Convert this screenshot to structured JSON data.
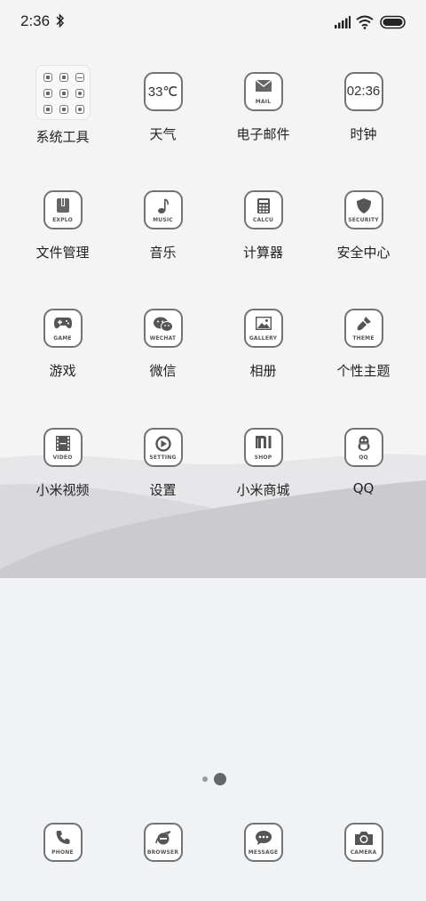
{
  "status": {
    "time": "2:36"
  },
  "folder": {
    "label": "系统工具"
  },
  "apps": [
    {
      "label": "天气",
      "caption": "",
      "big": "33℃"
    },
    {
      "label": "电子邮件",
      "caption": "MAIL",
      "big": ""
    },
    {
      "label": "时钟",
      "caption": "",
      "big": "02:36"
    },
    {
      "label": "文件管理",
      "caption": "EXPLO",
      "big": ""
    },
    {
      "label": "音乐",
      "caption": "MUSIC",
      "big": ""
    },
    {
      "label": "计算器",
      "caption": "CALCU",
      "big": ""
    },
    {
      "label": "安全中心",
      "caption": "SECURITY",
      "big": ""
    },
    {
      "label": "游戏",
      "caption": "GAME",
      "big": ""
    },
    {
      "label": "微信",
      "caption": "WECHAT",
      "big": ""
    },
    {
      "label": "相册",
      "caption": "GALLERY",
      "big": ""
    },
    {
      "label": "个性主题",
      "caption": "THEME",
      "big": ""
    },
    {
      "label": "小米视频",
      "caption": "VIDEO",
      "big": ""
    },
    {
      "label": "设置",
      "caption": "SETTING",
      "big": ""
    },
    {
      "label": "小米商城",
      "caption": "SHOP",
      "big": ""
    },
    {
      "label": "QQ",
      "caption": "QQ",
      "big": ""
    }
  ],
  "pager": {
    "pages": 2,
    "current": 2
  },
  "dock": [
    {
      "caption": "PHONE"
    },
    {
      "caption": "BROWSER"
    },
    {
      "caption": "MESSAGE"
    },
    {
      "caption": "CAMERA"
    }
  ]
}
